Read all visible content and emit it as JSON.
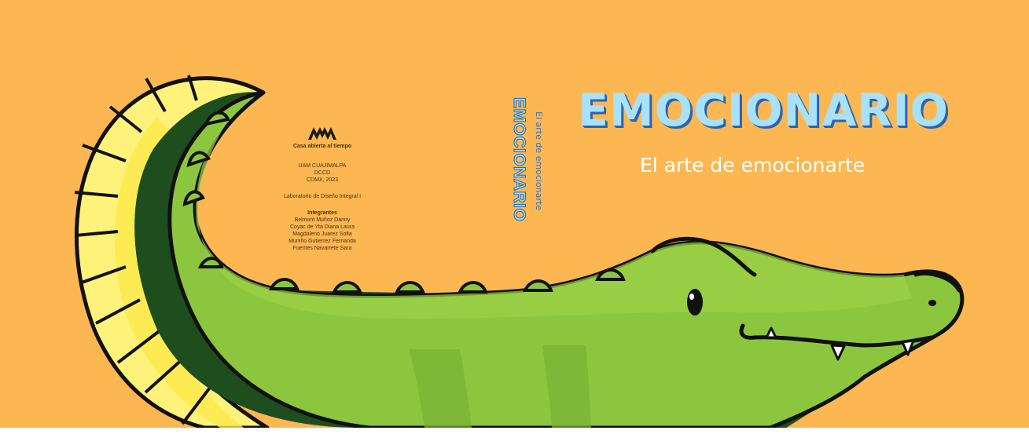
{
  "colors": {
    "background": "#FDB752",
    "title_fill": "#A9E1FA",
    "title_shadow": "#2A63B0",
    "croc_green": "#8CC63F",
    "croc_dark": "#1E4D1E",
    "tail_yellow": "#FFF27A"
  },
  "front": {
    "title": "EMOCIONARIO",
    "subtitle": "El arte de emocionarte"
  },
  "spine": {
    "title": "EMOCIONARIO",
    "subtitle": "El arte de emocionarte"
  },
  "back": {
    "logo_icon": "uam-logo-icon",
    "tagline": "Casa abierta al tiempo",
    "institution": [
      "UAM CUAJIMALPA",
      "DCCD",
      "CDMX, 2023"
    ],
    "course": "Laboratorio de Diseño Integral I",
    "members_heading": "Integrantes",
    "members": [
      "Belmont Muñoz Danny",
      "Coyac de Yta Diana Laura",
      "Magdaleno Juarez Sofia",
      "Muniño Gutierrez Fernanda",
      "Fuentes Navarrete Sara"
    ]
  }
}
